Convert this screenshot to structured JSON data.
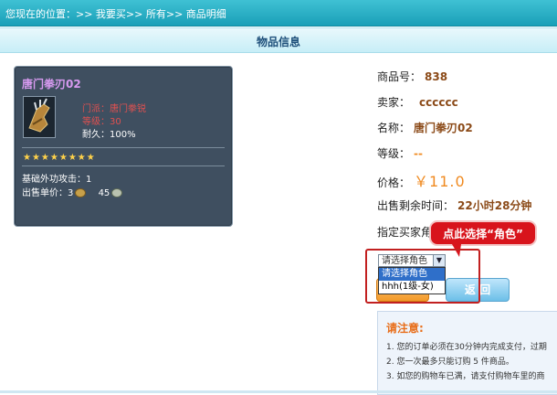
{
  "breadcrumb": {
    "text": "您现在的位置：>> 我要买>> 所有>> 商品明细"
  },
  "section": {
    "title": "物品信息"
  },
  "item_tooltip": {
    "name": "唐门拳刃02",
    "icon": "gauntlet-weapon-icon",
    "attrs": [
      "门派：唐门拳锐",
      "等级：30",
      "耐久：100%"
    ],
    "stars": "★★★★★★★★",
    "base_attack": "基础外功攻击：1",
    "price_label": "出售单价：",
    "price_gold": "3",
    "price_silver": "45"
  },
  "details": {
    "id_label": "商品号：",
    "id_value": "838",
    "seller_label": "卖家：",
    "seller_value": "cccccc",
    "name_label": "名称：",
    "name_value": "唐门拳刃02",
    "level_label": "等级：",
    "level_value": "--",
    "price_label": "价格：",
    "price_value": "￥11.0",
    "time_label": "出售剩余时间：",
    "time_value": "22小时28分钟",
    "buyer_label": "指定买家角"
  },
  "callout": {
    "text": "点此选择“角色”"
  },
  "role_select": {
    "selected": "请选择角色",
    "options": [
      "请选择角色",
      "hhh(1级-女)"
    ]
  },
  "buttons": {
    "back": "返  回"
  },
  "notice": {
    "title": "请注意:",
    "items": [
      "1.  您的订单必须在30分钟内完成支付，过期",
      "2.  您一次最多只能订购 5 件商品。",
      "3.  如您的购物车已满，请支付购物车里的商"
    ]
  },
  "colors": {
    "accent": "#1a9fb8",
    "price": "#f08a20",
    "callout": "#d8141c"
  }
}
